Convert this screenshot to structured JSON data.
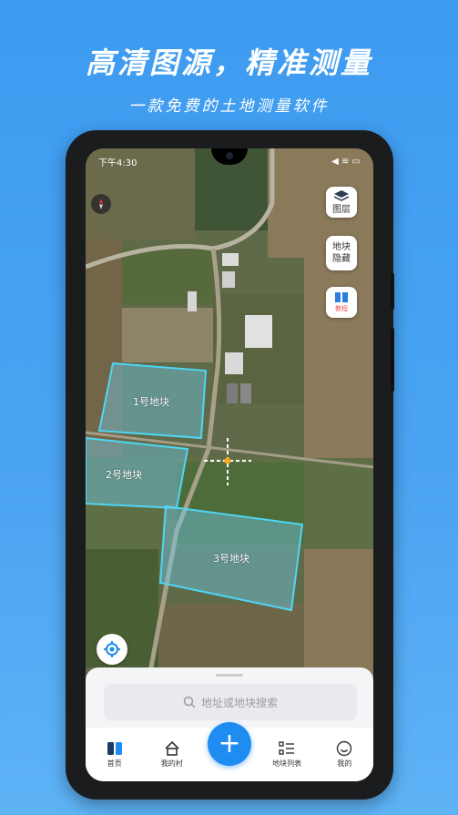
{
  "promo": {
    "headline": "高清图源，精准测量",
    "subline": "一款免费的土地测量软件"
  },
  "status_bar": {
    "time": "下午4:30",
    "right": "◀ ≋ ▭"
  },
  "map_controls": {
    "layers_label": "图层",
    "hide_plots_label": "地块\n隐藏",
    "hide_plots_line1": "地块",
    "hide_plots_line2": "隐藏",
    "book_label": "教程"
  },
  "plots": [
    {
      "label": "1号地块"
    },
    {
      "label": "2号地块"
    },
    {
      "label": "3号地块"
    }
  ],
  "search": {
    "placeholder": "地址或地块搜索"
  },
  "tabs": [
    {
      "label": "首页",
      "icon": "home-map-icon"
    },
    {
      "label": "我的村",
      "icon": "village-icon"
    },
    {
      "label": "+",
      "icon": "plus-icon"
    },
    {
      "label": "地块列表",
      "icon": "list-icon"
    },
    {
      "label": "我的",
      "icon": "smile-icon"
    }
  ],
  "colors": {
    "background": "#3d9bf0",
    "accent": "#1e8cf0",
    "plot_outline": "#4fd6f5",
    "crosshair_center": "#f5a623"
  }
}
